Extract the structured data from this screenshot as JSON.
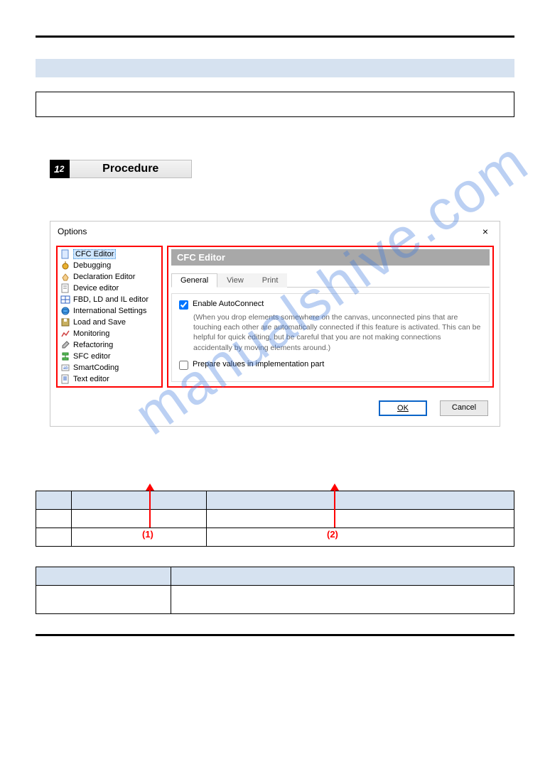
{
  "watermark": "manualshive.com",
  "heading": {
    "num": "1",
    "sub": "2",
    "label": "Procedure"
  },
  "dialog": {
    "title": "Options",
    "close": "×",
    "tree": [
      {
        "label": "CFC Editor",
        "icon": "doc-blue",
        "selected": true
      },
      {
        "label": "Debugging",
        "icon": "bug"
      },
      {
        "label": "Declaration Editor",
        "icon": "hand"
      },
      {
        "label": "Device editor",
        "icon": "doc"
      },
      {
        "label": "FBD, LD and IL editor",
        "icon": "grid"
      },
      {
        "label": "International Settings",
        "icon": "globe"
      },
      {
        "label": "Load and Save",
        "icon": "disk"
      },
      {
        "label": "Monitoring",
        "icon": "chart"
      },
      {
        "label": "Refactoring",
        "icon": "wrench"
      },
      {
        "label": "SFC editor",
        "icon": "sfc"
      },
      {
        "label": "SmartCoding",
        "icon": "smart"
      },
      {
        "label": "Text editor",
        "icon": "text"
      }
    ],
    "panel_title": "CFC Editor",
    "tabs": [
      {
        "label": "General",
        "active": true
      },
      {
        "label": "View",
        "active": false
      },
      {
        "label": "Print",
        "active": false
      }
    ],
    "check1_label": "Enable AutoConnect",
    "check1_hint": "(When you drop elements somewhere on the canvas, unconnected pins that are touching each other are automatically connected if this feature is activated. This can be helpful for quick editing, but be careful that you are not making connections accidentally by moving elements around.)",
    "check2_label": "Prepare values in implementation part",
    "ok": "OK",
    "cancel": "Cancel"
  },
  "callouts": {
    "one": "(1)",
    "two": "(2)"
  }
}
